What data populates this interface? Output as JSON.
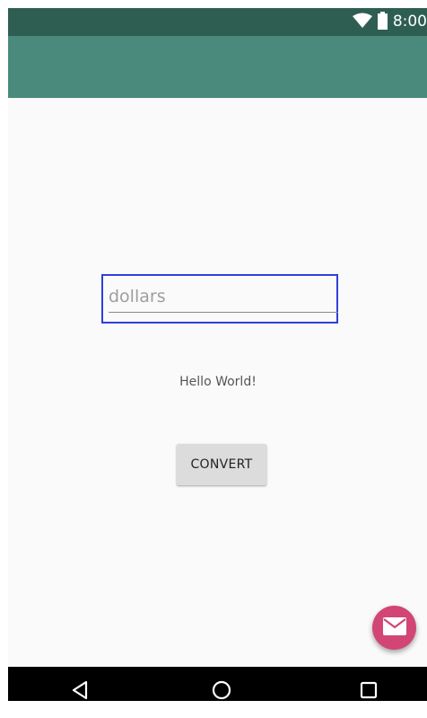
{
  "status_bar": {
    "time": "8:00",
    "icons": [
      "wifi-icon",
      "battery-icon"
    ]
  },
  "app_bar": {
    "color": "#4a8a7c"
  },
  "form": {
    "dollars_placeholder": "dollars",
    "dollars_value": "",
    "hello_text": "Hello World!",
    "convert_label": "CONVERT"
  },
  "fab": {
    "icon": "mail-icon",
    "color": "#d14675"
  },
  "nav_bar": {
    "buttons": [
      "back-icon",
      "home-icon",
      "recents-icon"
    ]
  }
}
